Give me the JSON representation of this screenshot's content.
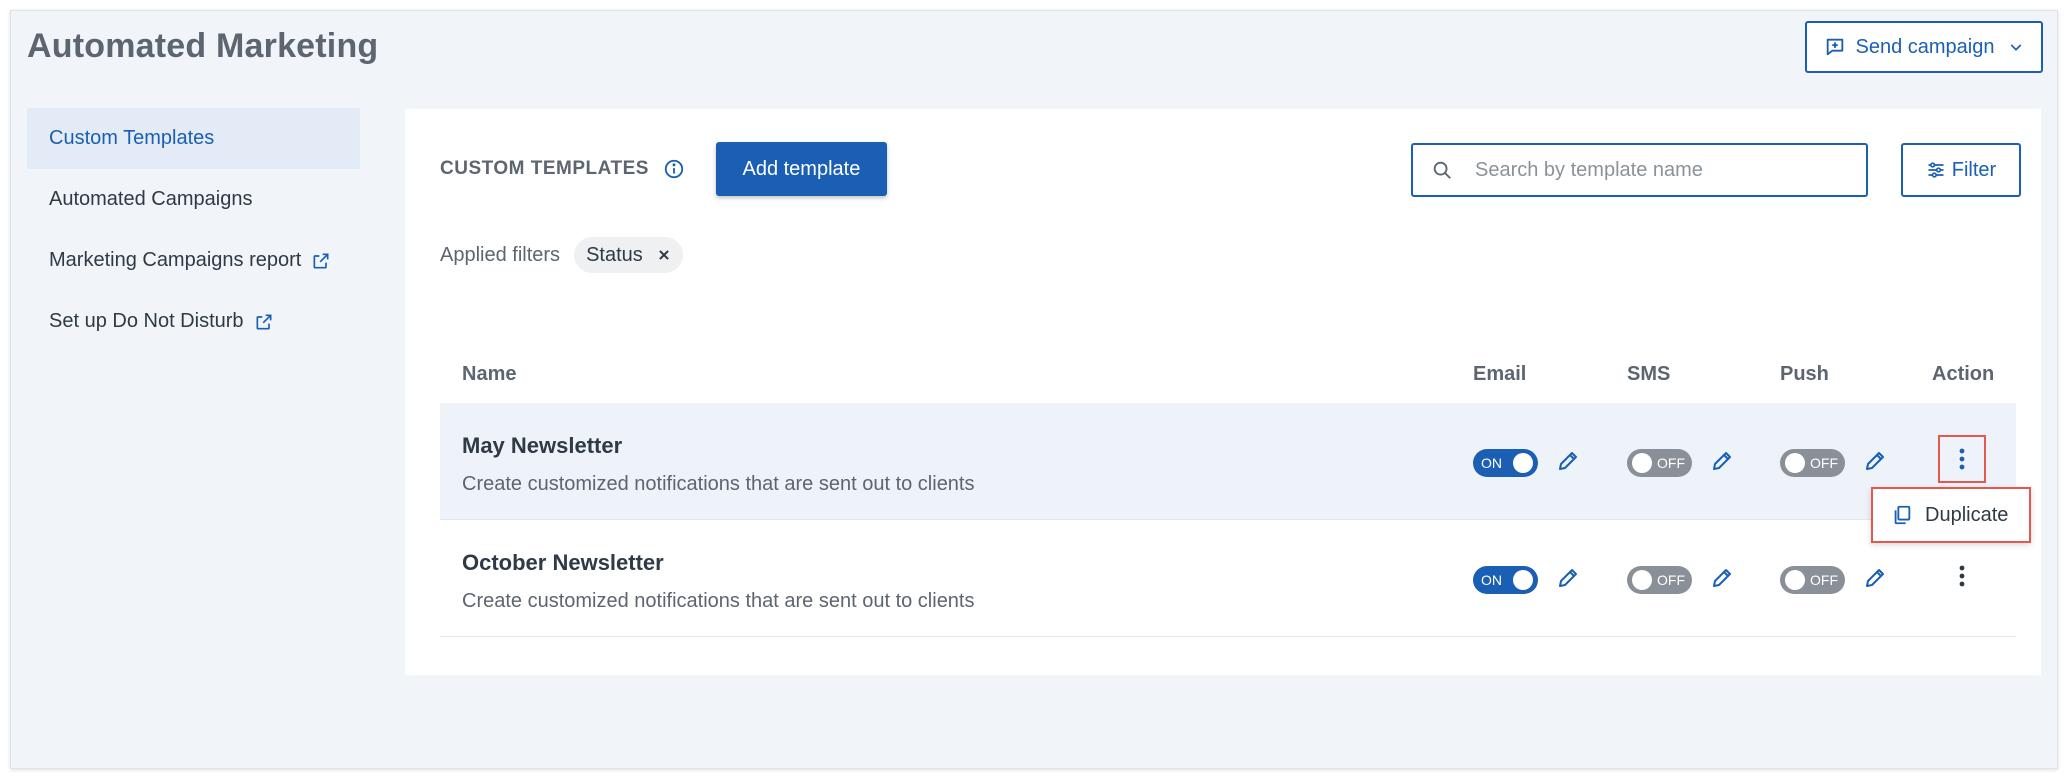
{
  "header": {
    "title": "Automated Marketing",
    "send_campaign_label": "Send campaign"
  },
  "sidebar": {
    "items": [
      {
        "label": "Custom Templates",
        "active": true
      },
      {
        "label": "Automated Campaigns"
      },
      {
        "label": "Marketing Campaigns report",
        "external": true
      },
      {
        "label": "Set up Do Not Disturb",
        "external": true
      }
    ]
  },
  "panel": {
    "section_title": "CUSTOM TEMPLATES",
    "add_template_label": "Add template",
    "search": {
      "placeholder": "Search by template name",
      "value": ""
    },
    "filter_label": "Filter",
    "applied_filters_label": "Applied filters",
    "filter_chips": [
      "Status"
    ]
  },
  "table": {
    "columns": [
      "Name",
      "Email",
      "SMS",
      "Push",
      "Action"
    ],
    "rows": [
      {
        "name": "May Newsletter",
        "description": "Create customized notifications that are sent out to clients",
        "email": "ON",
        "sms": "OFF",
        "push": "OFF"
      },
      {
        "name": "October Newsletter",
        "description": "Create customized notifications that are sent out to clients",
        "email": "ON",
        "sms": "OFF",
        "push": "OFF"
      }
    ]
  },
  "action_menu": {
    "items": [
      "Duplicate"
    ]
  },
  "colors": {
    "primary": "#1a5fb4",
    "highlight": "#e5584f",
    "toggle_off": "#8a9097",
    "background": "#f1f4f8"
  },
  "icons": {
    "send": "chat-plus-icon",
    "dropdown": "chevron-down-icon",
    "external": "external-link-icon",
    "info": "info-icon",
    "search": "search-icon",
    "filter": "sliders-icon",
    "remove": "close-icon",
    "edit": "pencil-icon",
    "more": "kebab-icon",
    "duplicate": "copy-icon"
  }
}
